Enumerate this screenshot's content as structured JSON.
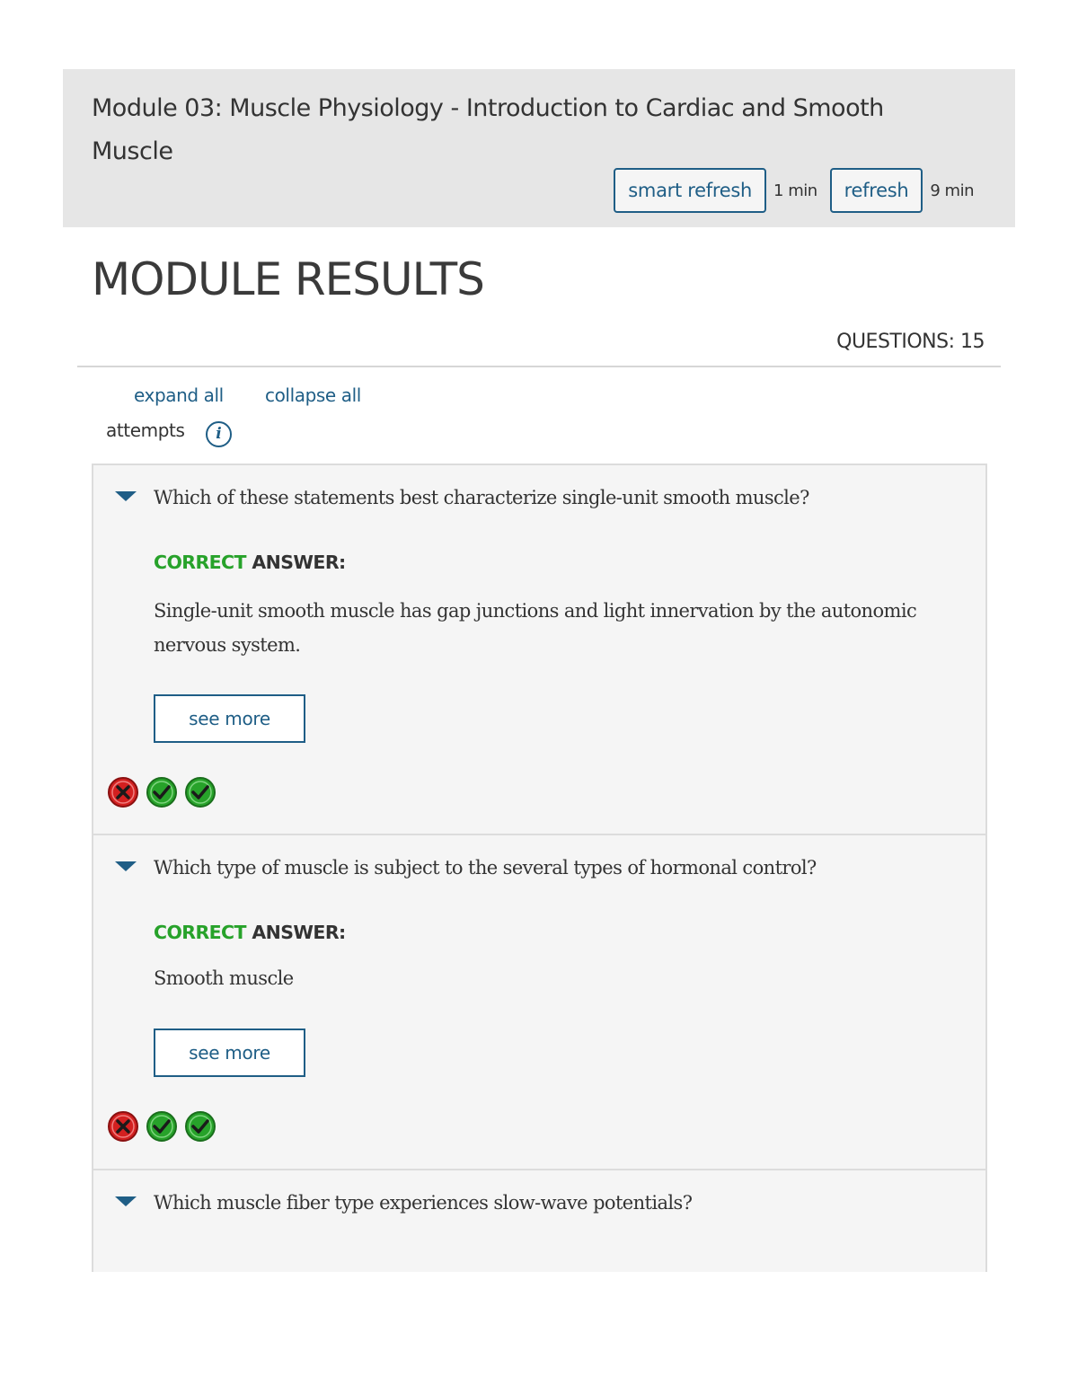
{
  "header": {
    "module_title": "Module 03: Muscle Physiology - Introduction to Cardiac and Smooth Muscle",
    "smart_refresh_label": "smart refresh",
    "smart_refresh_time": "1 min",
    "refresh_label": "refresh",
    "refresh_time": "9 min"
  },
  "results": {
    "title": "MODULE RESULTS",
    "questions_count": "QUESTIONS: 15",
    "expand_all": "expand all",
    "collapse_all": "collapse all",
    "attempts_label": "attempts",
    "info_icon_glyph": "i"
  },
  "questions": [
    {
      "text": "Which of these statements best characterize single-unit smooth muscle?",
      "answer_label_correct": "CORRECT",
      "answer_label_rest": " ANSWER:",
      "answer": "Single-unit smooth muscle has gap junctions and light innervation by the autonomic nervous system.",
      "see_more": "see more",
      "attempts": [
        "incorrect",
        "correct",
        "correct"
      ]
    },
    {
      "text": "Which type of muscle is subject to the several types of hormonal control?",
      "answer_label_correct": "CORRECT",
      "answer_label_rest": " ANSWER:",
      "answer": "Smooth muscle",
      "see_more": "see more",
      "attempts": [
        "incorrect",
        "correct",
        "correct"
      ]
    },
    {
      "text": "Which muscle fiber type experiences slow-wave potentials?"
    }
  ],
  "colors": {
    "accent": "#1f5e86",
    "correct": "#27a22a",
    "incorrect": "#d32020"
  }
}
